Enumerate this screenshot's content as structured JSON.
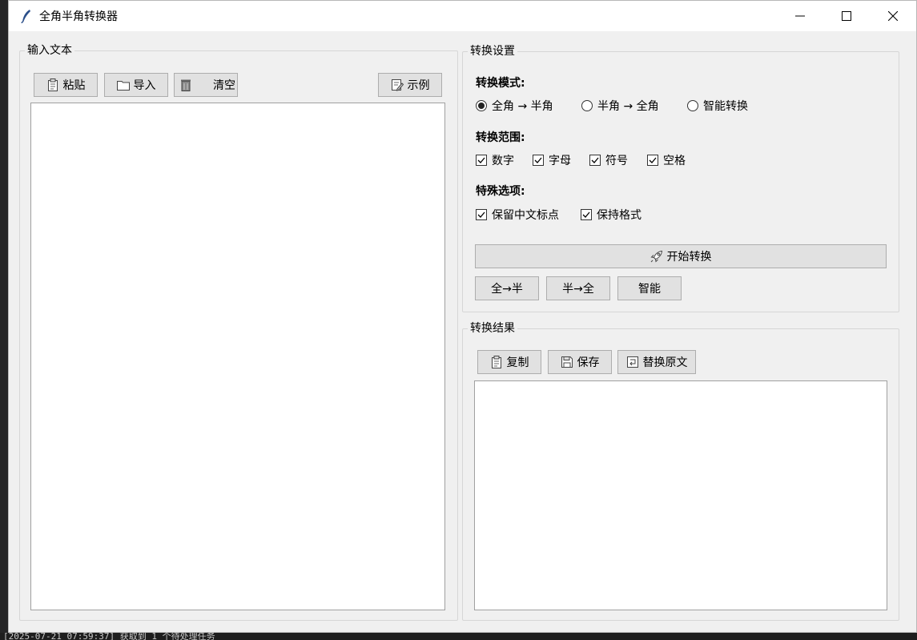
{
  "window": {
    "title": "全角半角转换器"
  },
  "input_panel": {
    "label": "输入文本",
    "buttons": {
      "paste": "粘贴",
      "import": "导入",
      "clear": "清空",
      "example": "示例"
    },
    "text_value": ""
  },
  "settings_panel": {
    "label": "转换设置",
    "mode_label": "转换模式:",
    "modes": [
      {
        "label": "全角 → 半角",
        "selected": true
      },
      {
        "label": "半角 → 全角",
        "selected": false
      },
      {
        "label": "智能转换",
        "selected": false
      }
    ],
    "range_label": "转换范围:",
    "ranges": [
      {
        "label": "数字",
        "checked": true
      },
      {
        "label": "字母",
        "checked": true
      },
      {
        "label": "符号",
        "checked": true
      },
      {
        "label": "空格",
        "checked": true
      }
    ],
    "special_label": "特殊选项:",
    "specials": [
      {
        "label": "保留中文标点",
        "checked": true
      },
      {
        "label": "保持格式",
        "checked": true
      }
    ],
    "start_button": "开始转换",
    "quick_buttons": [
      "全→半",
      "半→全",
      "智能"
    ]
  },
  "result_panel": {
    "label": "转换结果",
    "buttons": {
      "copy": "复制",
      "save": "保存",
      "replace": "替换原文"
    },
    "text_value": ""
  },
  "background_log": "[2025-07-21 07:59:37] 获取到 1 个待处理任务"
}
